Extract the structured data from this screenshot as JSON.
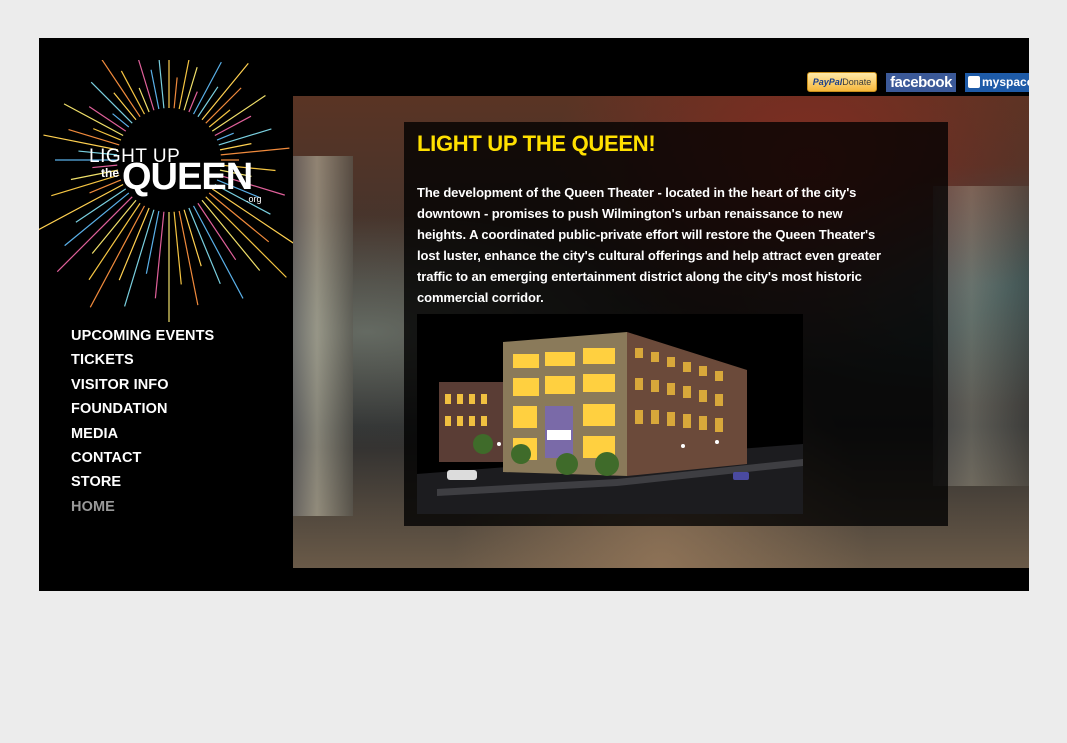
{
  "social": {
    "paypal_brand": "PayPal",
    "paypal_action": "Donate",
    "facebook": "facebook",
    "myspace": "myspace"
  },
  "logo": {
    "line1": "LIGHT UP",
    "line2": "the",
    "line3": "QUEEN",
    "line4": ".org"
  },
  "nav": {
    "items": [
      {
        "label": "UPCOMING EVENTS"
      },
      {
        "label": "TICKETS"
      },
      {
        "label": "VISITOR INFO"
      },
      {
        "label": "FOUNDATION"
      },
      {
        "label": "MEDIA"
      },
      {
        "label": "CONTACT"
      },
      {
        "label": "STORE"
      },
      {
        "label": "HOME"
      }
    ]
  },
  "main": {
    "heading": "LIGHT UP THE QUEEN!",
    "body": "The development of the Queen Theater - located in the heart of the city's downtown - promises to push Wilmington's urban renaissance to new heights. A coordinated public-private effort will restore the Queen Theater's lost luster, enhance the city's cultural offerings and help attract even greater traffic to an emerging entertainment district along the city's most historic commercial corridor."
  },
  "colors": {
    "heading": "#ffe000",
    "nav_active": "#9a9a9a",
    "facebook": "#3b5998",
    "myspace": "#1e5ba8"
  }
}
